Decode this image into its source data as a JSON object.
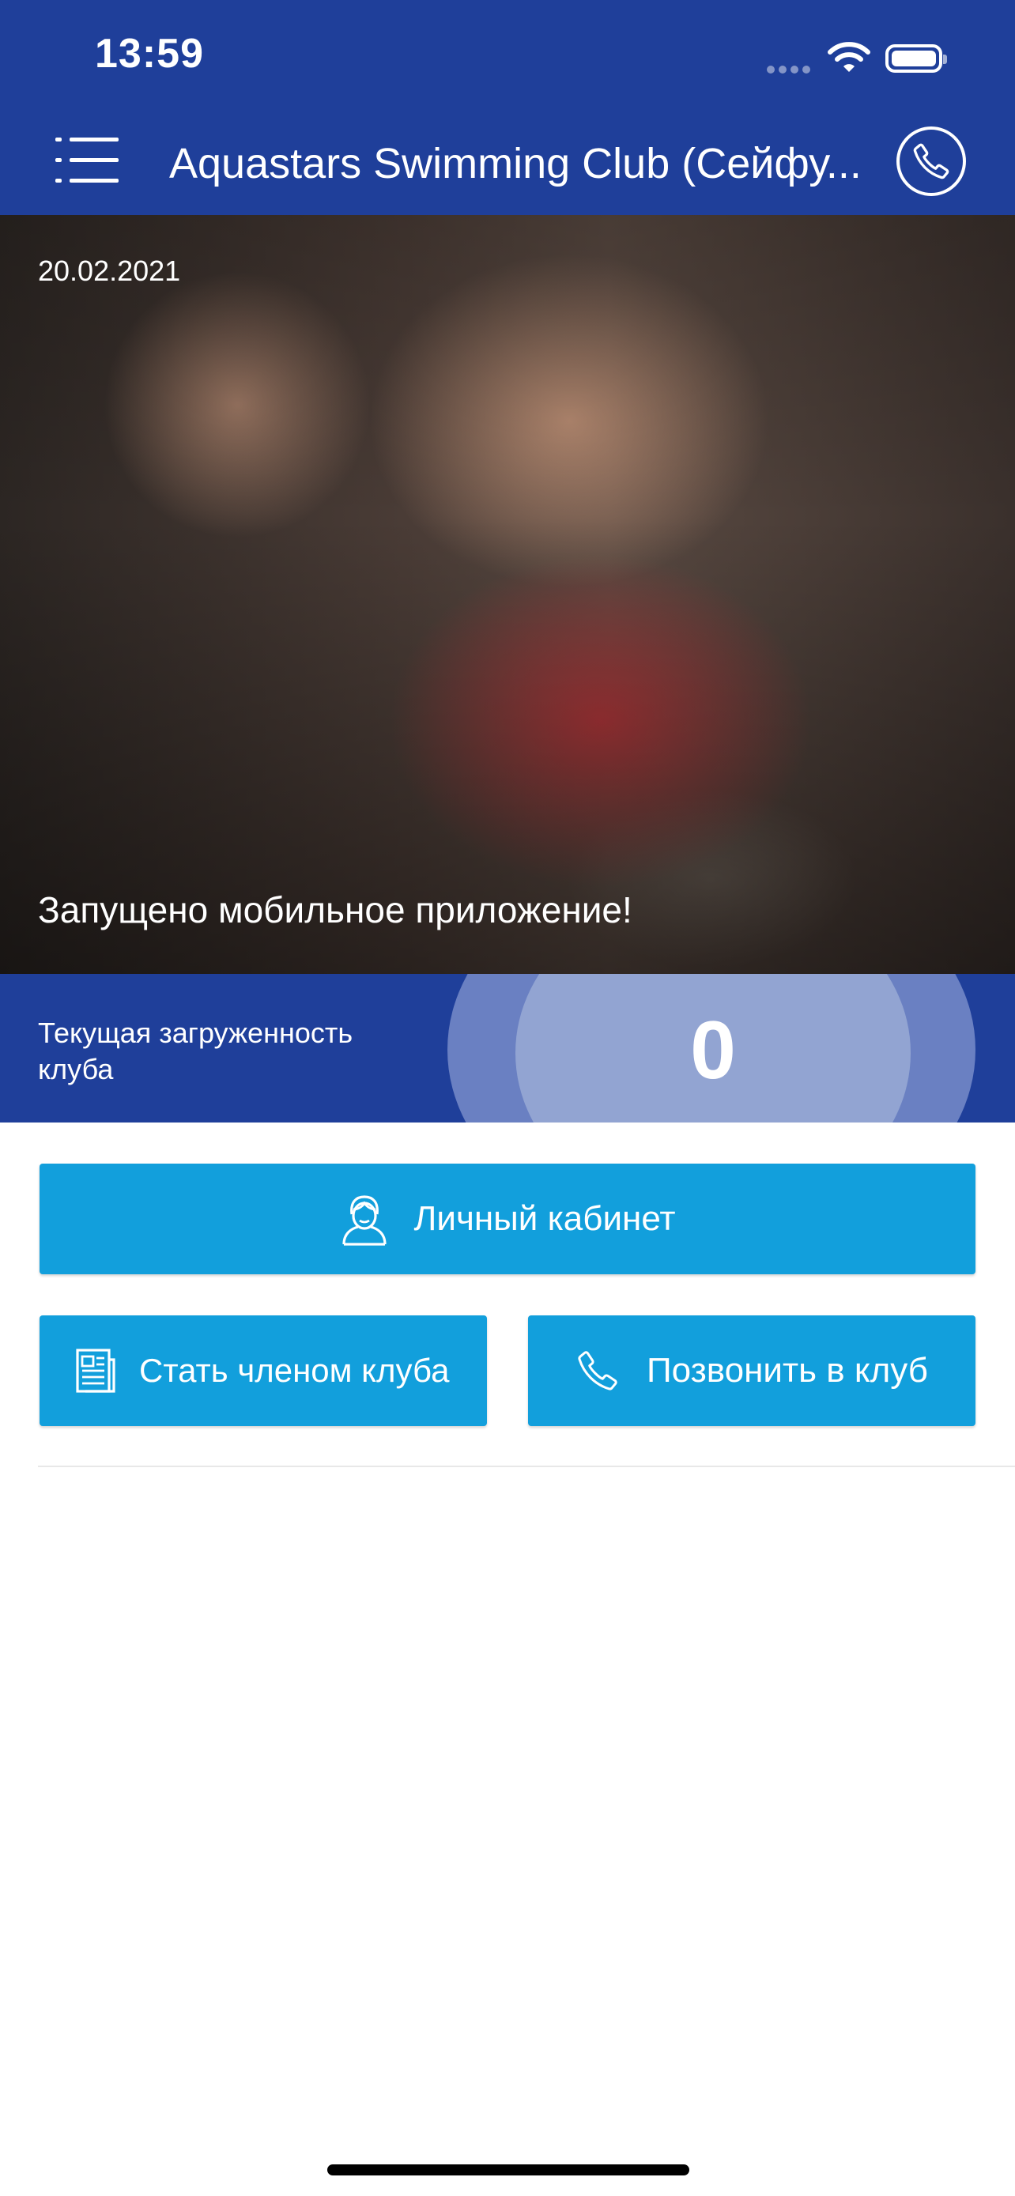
{
  "status_bar": {
    "time": "13:59"
  },
  "header": {
    "title": "Aquastars Swimming Club (Сейфу..."
  },
  "hero": {
    "date": "20.02.2021",
    "caption": "Запущено мобильное приложение!"
  },
  "club_load": {
    "label": "Текущая загруженность клуба",
    "value": "0"
  },
  "buttons": {
    "cabinet": "Личный кабинет",
    "member": "Стать членом клуба",
    "call": "Позвонить в клуб"
  },
  "colors": {
    "header_bg": "#1f3f9a",
    "button_bg": "#129fdc",
    "ring_outer": "#6a80c2",
    "ring_inner": "#92a4d2"
  },
  "icons": [
    "menu-icon",
    "phone-icon",
    "signal-icon",
    "wifi-icon",
    "battery-icon",
    "user-icon",
    "document-icon"
  ]
}
